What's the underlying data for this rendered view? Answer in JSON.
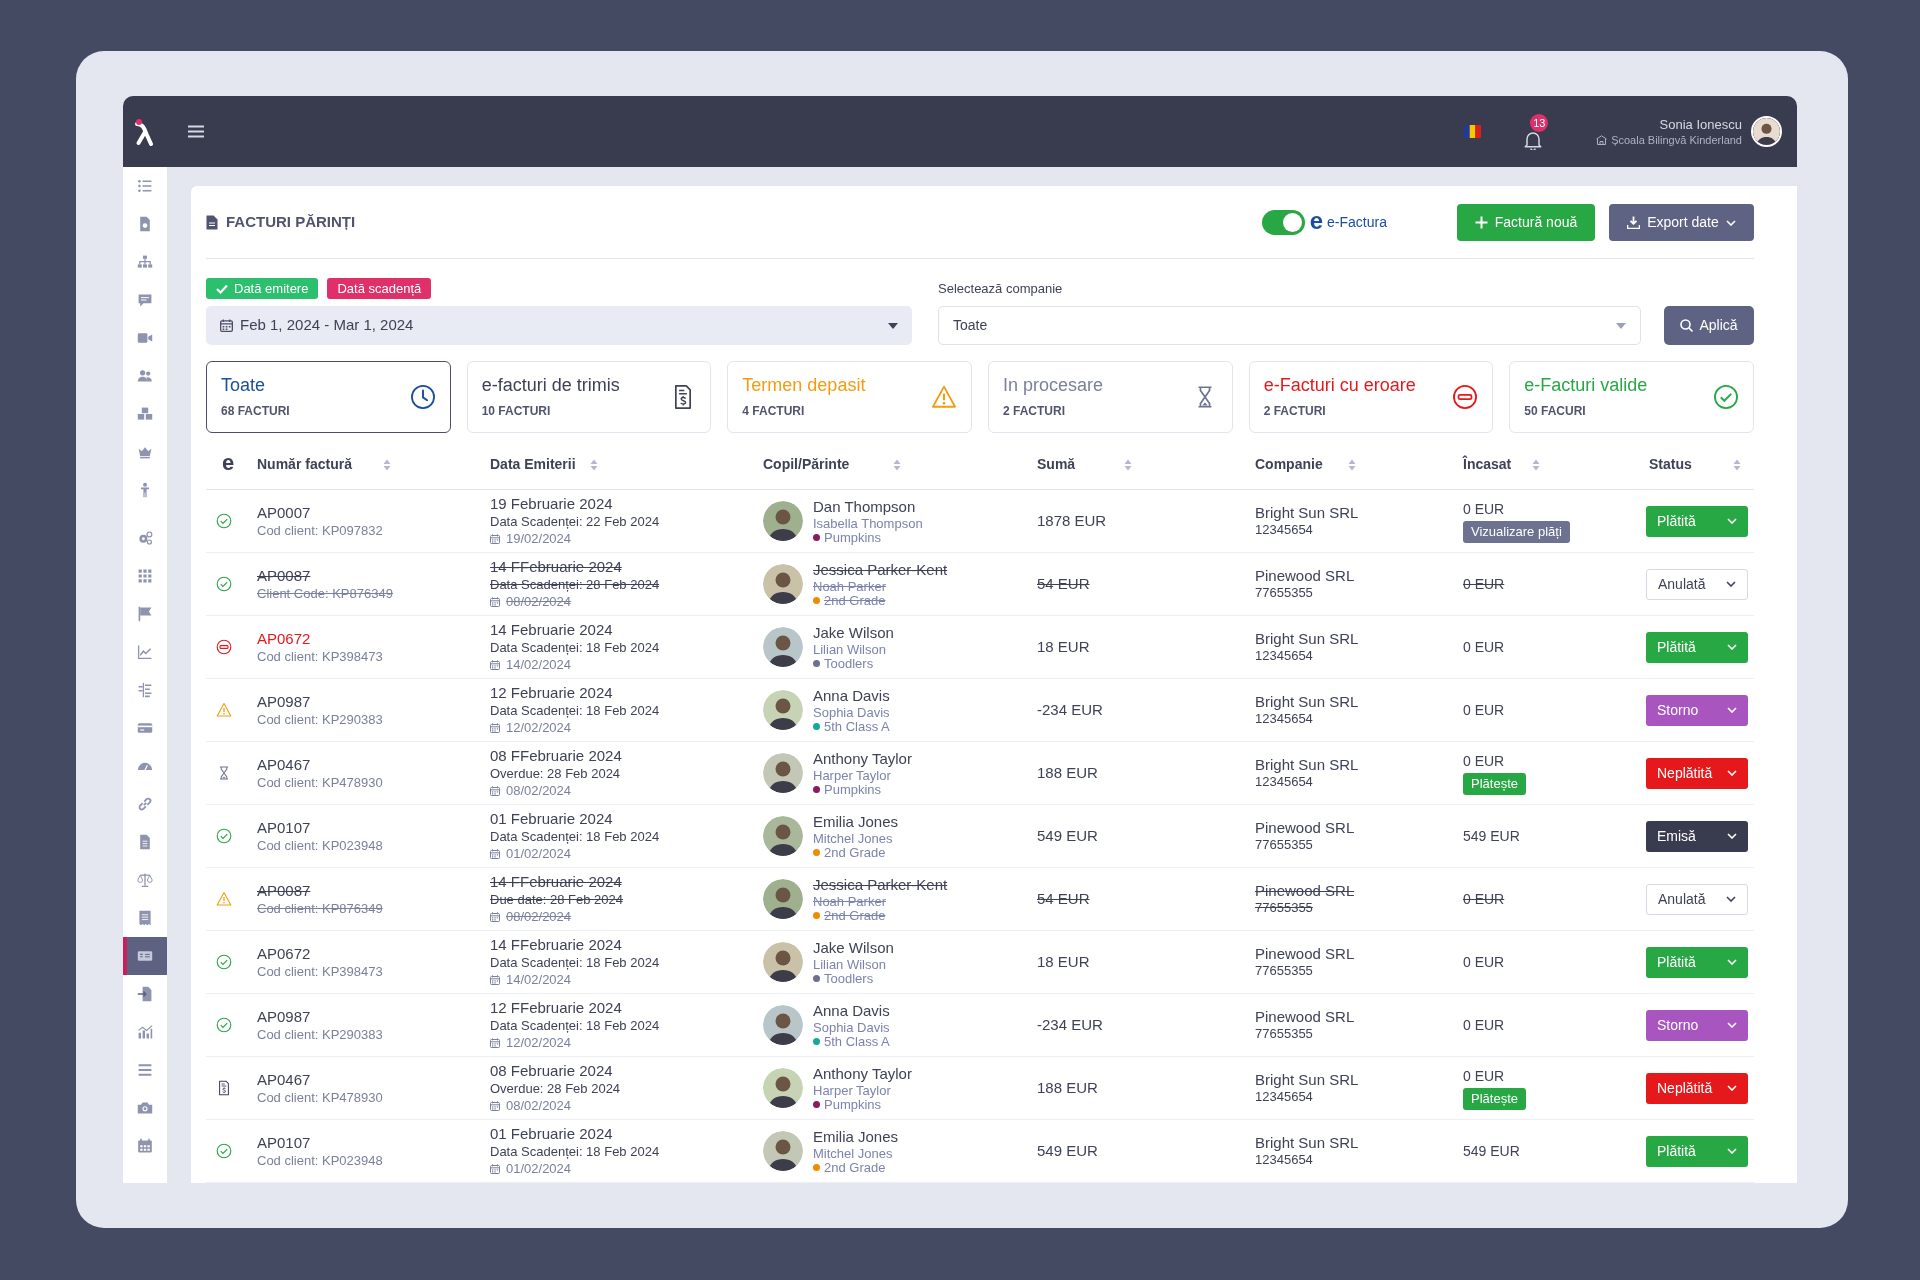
{
  "topbar": {
    "notifications": "13",
    "user": {
      "name": "Sonia Ionescu",
      "school": "Școala Bilingvă Kinderland"
    }
  },
  "sidebar": {
    "items": [
      {
        "selected": false
      },
      {
        "selected": false
      },
      {
        "selected": false
      },
      {
        "selected": false
      },
      {
        "selected": false
      },
      {
        "selected": false
      },
      {
        "selected": false
      },
      {
        "selected": false
      },
      {
        "selected": false
      },
      {
        "selected": false
      },
      {
        "selected": false
      },
      {
        "selected": false
      },
      {
        "selected": false
      },
      {
        "selected": false
      },
      {
        "selected": false
      },
      {
        "selected": false
      },
      {
        "selected": false
      },
      {
        "selected": false
      },
      {
        "selected": false
      },
      {
        "selected": false
      },
      {
        "selected": true
      },
      {
        "selected": false
      },
      {
        "selected": false
      },
      {
        "selected": false
      },
      {
        "selected": false
      },
      {
        "selected": false
      }
    ]
  },
  "page": {
    "title": "FACTURI PĂRINȚI",
    "efactura": {
      "logo": "e",
      "label": "e-Factura",
      "on": true
    },
    "buttons": {
      "new_invoice": "Factură nouă",
      "export": "Export date"
    }
  },
  "filters": {
    "date_types": [
      {
        "label": "Dată emitere",
        "selected": true
      },
      {
        "label": "Dată scadență",
        "selected": false
      }
    ],
    "date_range": "Feb 1, 2024 - Mar 1, 2024",
    "company": {
      "label": "Selectează companie",
      "value": "Toate"
    },
    "apply": "Aplică"
  },
  "summary_cards": [
    {
      "kind": "all",
      "title": "Toate",
      "count": "68 FACTURI",
      "selected": true
    },
    {
      "kind": "to_send",
      "title": "e-facturi de trimis",
      "count": "10 FACTURI",
      "selected": false
    },
    {
      "kind": "warning",
      "title": "Termen depasit",
      "count": "4 FACTURI",
      "selected": false
    },
    {
      "kind": "processing",
      "title": "In procesare",
      "count": "2 FACTURI",
      "selected": false
    },
    {
      "kind": "error",
      "title": "e-Facturi cu eroare",
      "count": "2 FACTURI",
      "selected": false
    },
    {
      "kind": "valid",
      "title": "e-Facturi valide",
      "count": "50 FACURI",
      "selected": false
    }
  ],
  "table": {
    "columns": [
      "e",
      "Număr factură",
      "Data Emiterii",
      "Copil/Părinte",
      "Sumă",
      "Companie",
      "Încasat",
      "Status"
    ],
    "rows": [
      {
        "kind": "valid",
        "number": "AP0007",
        "client_code": "Cod client: KP097832",
        "date": "19 Februarie 2024",
        "due": "Data Scadenței: 22 Feb 2024",
        "issued": "19/02/2024",
        "parent": "Dan Thompson",
        "child": "Isabella Thompson",
        "group": {
          "name": "Pumpkins",
          "color": "#8b1a5e"
        },
        "amount": "1878 EUR",
        "company": "Bright Sun SRL",
        "company_code": "12345654",
        "collected": "0 EUR",
        "action": {
          "kind": "view",
          "label": "Vizualizare plăți"
        },
        "status": {
          "kind": "paid",
          "label": "Plătită"
        },
        "cancelled": false,
        "company_cancelled": false
      },
      {
        "kind": "valid",
        "number": "AP0087",
        "client_code": "Client Code: KP876349",
        "date": "14 FFebruarie 2024",
        "due": "Data Scadenței: 28 Feb 2024",
        "issued": "08/02/2024",
        "parent": "Jessica Parker-Kent",
        "child": "Noah Parker",
        "group": {
          "name": "2nd Grade",
          "color": "#f08a00"
        },
        "amount": "54 EUR",
        "company": "Pinewood SRL",
        "company_code": "77655355",
        "collected": "0 EUR",
        "status": {
          "kind": "cancelled",
          "label": "Anulată"
        },
        "cancelled": true,
        "company_cancelled": false
      },
      {
        "kind": "error",
        "number": "AP0672",
        "client_code": "Cod client: KP398473",
        "date": "14 Februarie 2024",
        "due": "Data Scadenței: 18 Feb 2024",
        "issued": "14/02/2024",
        "parent": "Jake Wilson",
        "child": "Lilian Wilson",
        "group": {
          "name": "Toodlers",
          "color": "#6b7090"
        },
        "amount": "18 EUR",
        "company": "Bright Sun SRL",
        "company_code": "12345654",
        "collected": "0 EUR",
        "status": {
          "kind": "paid",
          "label": "Plătită"
        },
        "cancelled": false,
        "company_cancelled": false
      },
      {
        "kind": "warning",
        "number": "AP0987",
        "client_code": "Cod client: KP290383",
        "date": "12 Februarie 2024",
        "due": "Data Scadenței: 18 Feb 2024",
        "issued": "12/02/2024",
        "parent": "Anna Davis",
        "child": "Sophia Davis",
        "group": {
          "name": "5th Class A",
          "color": "#16a99a"
        },
        "amount": "-234 EUR",
        "company": "Bright Sun SRL",
        "company_code": "12345654",
        "collected": "0 EUR",
        "status": {
          "kind": "storno",
          "label": "Storno"
        },
        "cancelled": false,
        "company_cancelled": false
      },
      {
        "kind": "processing",
        "number": "AP0467",
        "client_code": "Cod client: KP478930",
        "date": "08 FFebruarie 2024",
        "due": "Overdue: 28 Feb 2024",
        "issued": "08/02/2024",
        "parent": "Anthony Taylor",
        "child": "Harper Taylor",
        "group": {
          "name": "Pumpkins",
          "color": "#8b1a5e"
        },
        "amount": "188 EUR",
        "company": "Bright Sun SRL",
        "company_code": "12345654",
        "collected": "0 EUR",
        "action": {
          "kind": "pay",
          "label": "Plătește"
        },
        "status": {
          "kind": "unpaid",
          "label": "Neplătită"
        },
        "cancelled": false,
        "company_cancelled": false
      },
      {
        "kind": "valid",
        "number": "AP0107",
        "client_code": "Cod client: KP023948",
        "date": "01 Februarie 2024",
        "due": "Data Scadenței: 18 Feb 2024",
        "issued": "01/02/2024",
        "parent": "Emilia Jones",
        "child": "Mitchel Jones",
        "group": {
          "name": "2nd Grade",
          "color": "#f08a00"
        },
        "amount": "549 EUR",
        "company": "Pinewood SRL",
        "company_code": "77655355",
        "collected": "549 EUR",
        "status": {
          "kind": "issued",
          "label": "Emisă"
        },
        "cancelled": false,
        "company_cancelled": false
      },
      {
        "kind": "warning",
        "number": "AP0087",
        "client_code": "Cod client: KP876349",
        "date": "14 FFebruarie 2024",
        "due": "Due date: 28 Feb 2024",
        "issued": "08/02/2024",
        "parent": "Jessica Parker-Kent",
        "child": "Noah Parker",
        "group": {
          "name": "2nd Grade",
          "color": "#f08a00"
        },
        "amount": "54 EUR",
        "company": "Pinewood SRL",
        "company_code": "77655355",
        "collected": "0 EUR",
        "status": {
          "kind": "cancelled",
          "label": "Anulată"
        },
        "cancelled": true,
        "company_cancelled": true
      },
      {
        "kind": "valid",
        "number": "AP0672",
        "client_code": "Cod client: KP398473",
        "date": "14 FFebruarie 2024",
        "due": "Data Scadenței: 18 Feb 2024",
        "issued": "14/02/2024",
        "parent": "Jake Wilson",
        "child": "Lilian Wilson",
        "group": {
          "name": "Toodlers",
          "color": "#6b7090"
        },
        "amount": "18 EUR",
        "company": "Pinewood SRL",
        "company_code": "77655355",
        "collected": "0 EUR",
        "status": {
          "kind": "paid",
          "label": "Plătită"
        },
        "cancelled": false,
        "company_cancelled": false
      },
      {
        "kind": "valid",
        "number": "AP0987",
        "client_code": "Cod client: KP290383",
        "date": "12 FFebruarie 2024",
        "due": "Data Scadenței: 18 Feb 2024",
        "issued": "12/02/2024",
        "parent": "Anna Davis",
        "child": "Sophia Davis",
        "group": {
          "name": "5th Class A",
          "color": "#16a99a"
        },
        "amount": "-234 EUR",
        "company": "Pinewood SRL",
        "company_code": "77655355",
        "collected": "0 EUR",
        "status": {
          "kind": "storno",
          "label": "Storno"
        },
        "cancelled": false,
        "company_cancelled": false
      },
      {
        "kind": "to_send",
        "number": "AP0467",
        "client_code": "Cod client: KP478930",
        "date": "08 Februarie 2024",
        "due": "Overdue: 28 Feb 2024",
        "issued": "08/02/2024",
        "parent": "Anthony Taylor",
        "child": "Harper Taylor",
        "group": {
          "name": "Pumpkins",
          "color": "#8b1a5e"
        },
        "amount": "188 EUR",
        "company": "Bright Sun SRL",
        "company_code": "12345654",
        "collected": "0 EUR",
        "action": {
          "kind": "pay",
          "label": "Plătește"
        },
        "status": {
          "kind": "unpaid",
          "label": "Neplătită"
        },
        "cancelled": false,
        "company_cancelled": false
      },
      {
        "kind": "valid",
        "number": "AP0107",
        "client_code": "Cod client: KP023948",
        "date": "01 Februarie 2024",
        "due": "Data Scadenței: 18 Feb 2024",
        "issued": "01/02/2024",
        "parent": "Emilia Jones",
        "child": "Mitchel Jones",
        "group": {
          "name": "2nd Grade",
          "color": "#f08a00"
        },
        "amount": "549 EUR",
        "company": "Bright Sun SRL",
        "company_code": "12345654",
        "collected": "549 EUR",
        "status": {
          "kind": "paid",
          "label": "Plătită"
        },
        "cancelled": false,
        "company_cancelled": false
      }
    ]
  }
}
